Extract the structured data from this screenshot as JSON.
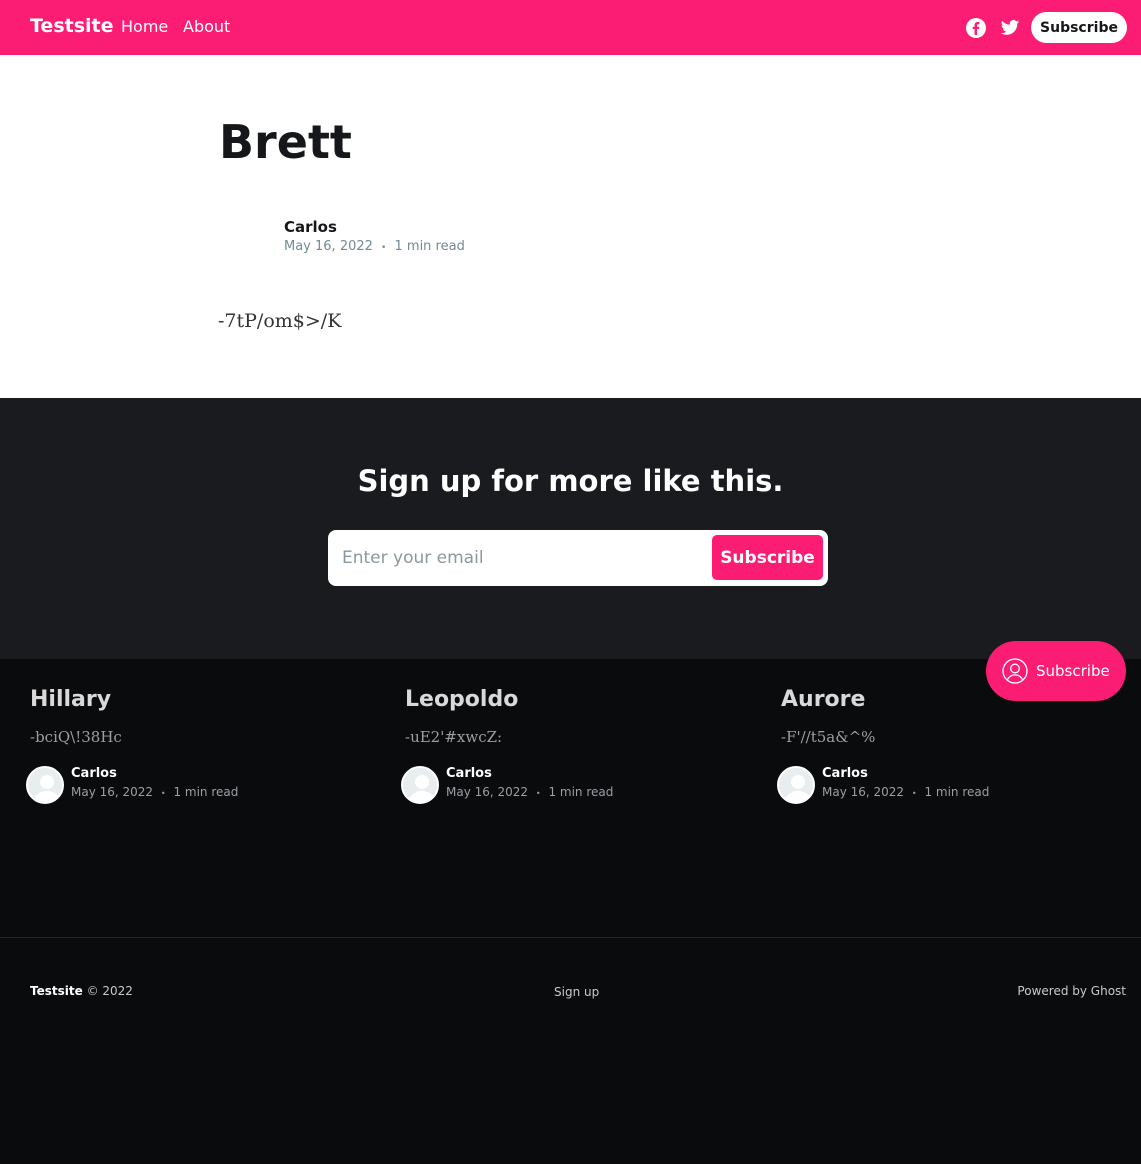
{
  "header": {
    "brand": "Testsite",
    "nav": [
      "Home",
      "About"
    ],
    "social_icons": [
      "facebook-icon",
      "twitter-icon"
    ],
    "subscribe_label": "Subscribe",
    "accent_color": "#fb1c73"
  },
  "article": {
    "title": "Brett",
    "author": "Carlos",
    "date": "May 16, 2022",
    "separator": "•",
    "read_time": "1 min read",
    "body": "-7tP/om$>/K"
  },
  "signup": {
    "title": "Sign up for more like this.",
    "email_placeholder": "Enter your email",
    "button_label": "Subscribe"
  },
  "related": [
    {
      "title": "Hillary",
      "excerpt": "-bciQ\\!38Hc",
      "author": "Carlos",
      "date": "May 16, 2022",
      "read_time": "1 min read"
    },
    {
      "title": "Leopoldo",
      "excerpt": "-uE2'#xwcZ:",
      "author": "Carlos",
      "date": "May 16, 2022",
      "read_time": "1 min read"
    },
    {
      "title": "Aurore",
      "excerpt": "-F'//t5a&^%",
      "author": "Carlos",
      "date": "May 16, 2022",
      "read_time": "1 min read"
    }
  ],
  "floating_subscribe": {
    "label": "Subscribe",
    "icon": "user-circle-icon"
  },
  "footer": {
    "brand": "Testsite",
    "copyright": "© 2022",
    "signup_link": "Sign up",
    "powered": "Powered by Ghost"
  }
}
